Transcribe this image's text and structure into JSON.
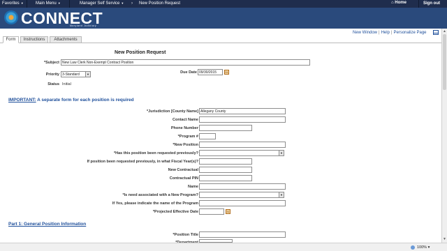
{
  "topnav": {
    "favorites": "Favorites",
    "main_menu": "Main Menu",
    "breadcrumb_1": "Manager Self Service",
    "breadcrumb_2": "New Position Request",
    "home": "Home",
    "signout": "Sign out"
  },
  "brand": {
    "name": "CONNECT",
    "sub": "Maryland Judiciary"
  },
  "toplinks": {
    "new_window": "New Window",
    "help": "Help",
    "personalize": "Personalize Page"
  },
  "tabs": [
    "Form",
    "Instructions",
    "Attachments"
  ],
  "form": {
    "title": "New Position Request",
    "subject_label": "*Subject",
    "subject_value": "New Law Clerk Non-Exempt Contract Position",
    "priority_label": "Priority",
    "priority_value": "3-Standard",
    "due_date_label": "Due Date",
    "due_date_value": "09/30/2015",
    "status_label": "Status",
    "status_value": "Initial"
  },
  "important": {
    "prefix": "IMPORTANT:",
    "text": " A separate form for each position is required"
  },
  "fields": {
    "jurisdiction_label": "*Jurisdiction [County Name]",
    "jurisdiction_value": "Allegany County",
    "contact_name_label": "Contact Name",
    "phone_label": "Phone Number",
    "program_label": "*Program #",
    "new_position_label": "*New Position",
    "requested_prev_label": "*Has this position been requested previously?",
    "fiscal_year_label": "If position been requested previously, in what Fiscal Year(s)?",
    "new_contractual_label": "New Contractual",
    "contractual_pin_label": "Contractual PIN",
    "name_label": "Name",
    "new_program_label": "*Is need associated with a New Program?",
    "program_name_label": "If Yes, please indicate the name of the Program",
    "effective_date_label": "*Projected Effective Date"
  },
  "part1": {
    "heading": "Part 1: General Position Information",
    "position_title_label": "*Position Title",
    "department_label": "*Department"
  },
  "statusbar": {
    "zoom": "100%"
  }
}
